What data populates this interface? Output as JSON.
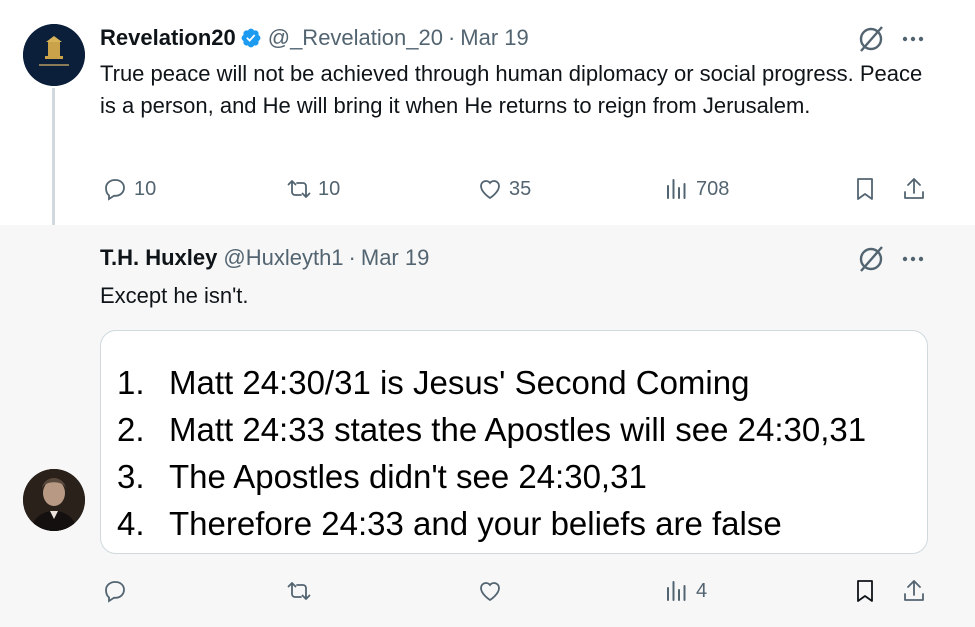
{
  "tweets": [
    {
      "display_name": "Revelation20",
      "handle": "@_Revelation_20",
      "separator": "·",
      "date": "Mar 19",
      "text": "True peace will not be achieved through human diplomacy or social progress. Peace is a person, and He will bring it when He returns to reign from Jerusalem.",
      "verified": true,
      "stats": {
        "replies": "10",
        "reposts": "10",
        "likes": "35",
        "views": "708"
      }
    },
    {
      "display_name": "T.H. Huxley",
      "handle": "@Huxleyth1",
      "separator": "·",
      "date": "Mar 19",
      "text": "Except he isn't.",
      "stats": {
        "views": "4"
      },
      "image_text": [
        {
          "num": "1.",
          "text": "Matt 24:30/31 is Jesus' Second Coming"
        },
        {
          "num": "2.",
          "text": "Matt 24:33 states the Apostles will see 24:30,31"
        },
        {
          "num": "3.",
          "text": "The Apostles didn't see 24:30,31"
        },
        {
          "num": "4.",
          "text": "Therefore 24:33 and your beliefs are false"
        }
      ]
    }
  ],
  "icons": {
    "reply": "reply-icon",
    "repost": "repost-icon",
    "like": "like-icon",
    "views": "views-icon",
    "bookmark": "bookmark-icon",
    "share": "share-icon",
    "grok": "grok-icon",
    "more": "more-icon",
    "verified": "verified-badge-icon"
  },
  "colors": {
    "text": "#0f1419",
    "secondary": "#536471",
    "verified": "#1d9bf0",
    "thread_line": "#cfd9de"
  }
}
